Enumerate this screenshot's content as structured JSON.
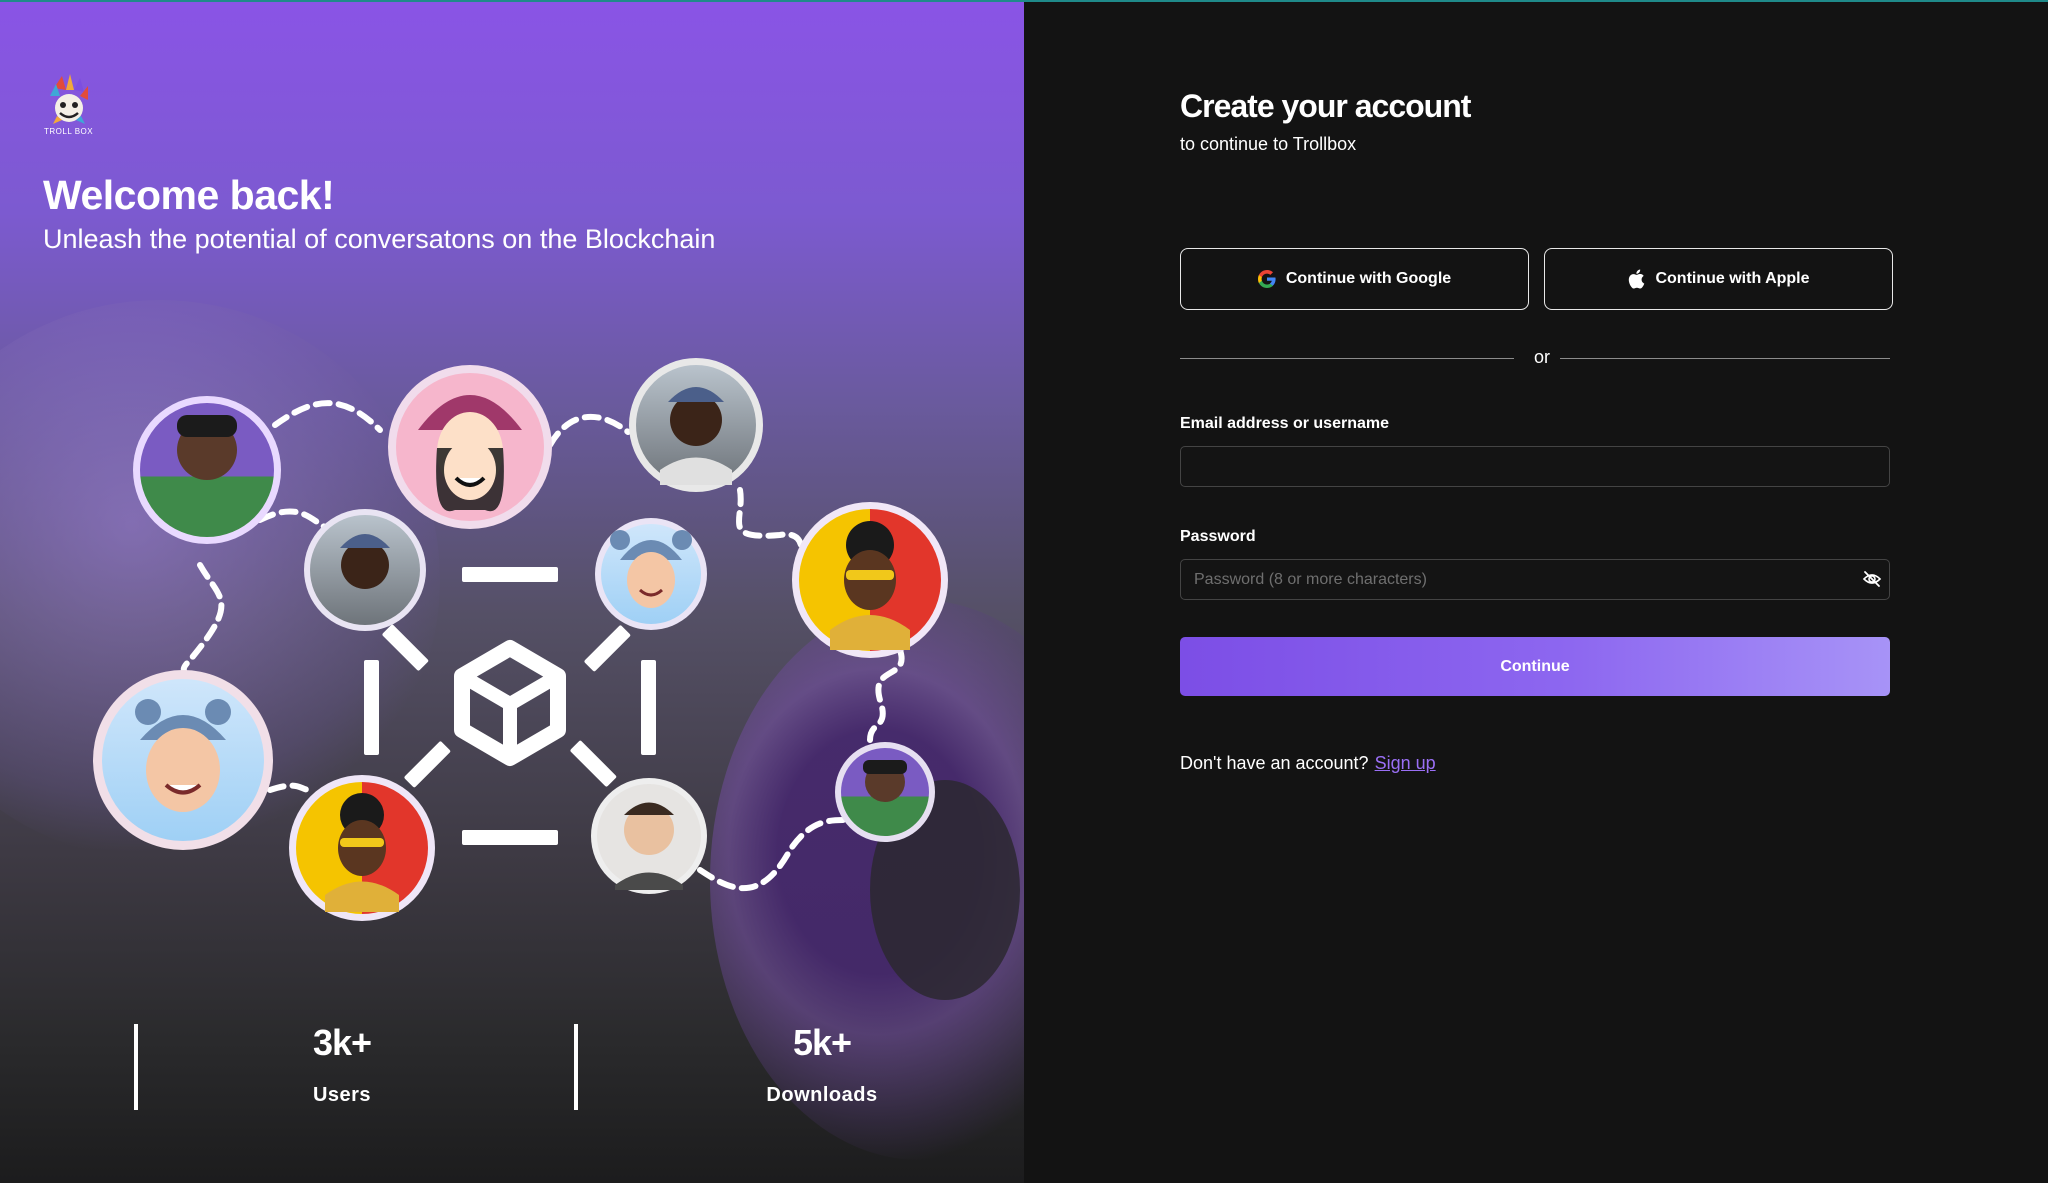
{
  "hero": {
    "brand": "TROLL BOX",
    "title": "Welcome back!",
    "subtitle": "Unleash the potential of conversatons on the Blockchain"
  },
  "stats": [
    {
      "value": "3k+",
      "label": "Users"
    },
    {
      "value": "5k+",
      "label": "Downloads"
    }
  ],
  "form": {
    "title": "Create your account",
    "subtitle": "to continue to Trollbox",
    "google_label": "Continue with Google",
    "apple_label": "Continue with Apple",
    "divider": "or",
    "email_label": "Email address or username",
    "email_value": "",
    "password_label": "Password",
    "password_placeholder": "Password (8 or more characters)",
    "continue_label": "Continue",
    "no_account_text": "Don't have an account?",
    "signup_label": "Sign up"
  },
  "icons": {
    "password_toggle": "eye-off-icon",
    "hub": "cube-icon"
  },
  "colors": {
    "accent": "#8d67f0",
    "link": "#9a6ff5",
    "background": "#131313"
  }
}
